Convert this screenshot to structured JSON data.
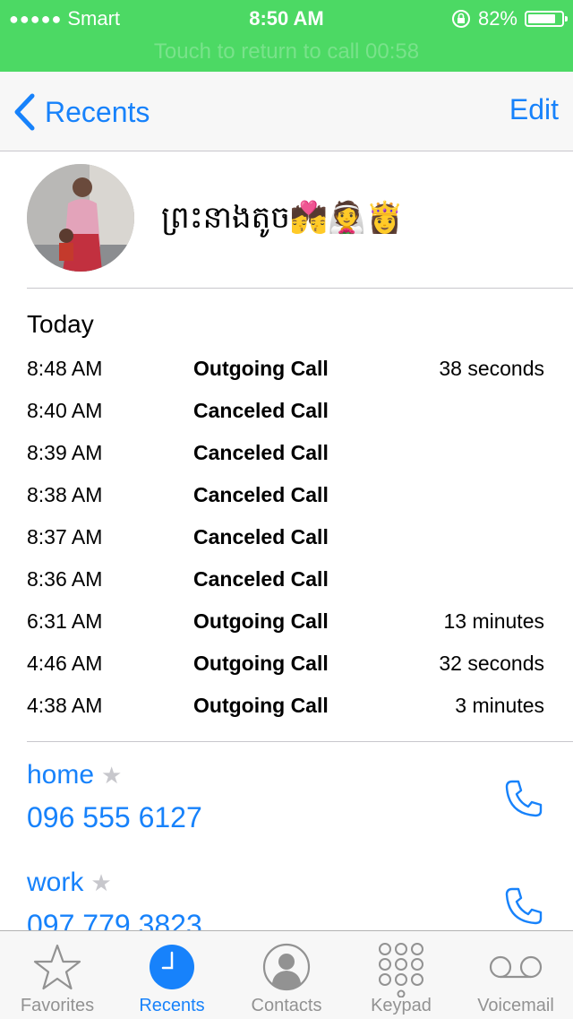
{
  "status_bar": {
    "signal": "●●●●●",
    "carrier": "Smart",
    "time": "8:50 AM",
    "battery_percent_label": "82%",
    "battery_level": 0.82,
    "return_hint": "Touch to return to call 00:58",
    "background_color": "#4cd964"
  },
  "nav": {
    "back_label": "Recents",
    "edit_label": "Edit",
    "accent_color": "#1782fb"
  },
  "contact": {
    "name": "ព្រះនាងតូច💏👰👸"
  },
  "call_log": {
    "day": "Today",
    "rows": [
      {
        "time": "8:48 AM",
        "kind": "Outgoing Call",
        "duration": "38 seconds"
      },
      {
        "time": "8:40 AM",
        "kind": "Canceled Call",
        "duration": ""
      },
      {
        "time": "8:39 AM",
        "kind": "Canceled Call",
        "duration": ""
      },
      {
        "time": "8:38 AM",
        "kind": "Canceled Call",
        "duration": ""
      },
      {
        "time": "8:37 AM",
        "kind": "Canceled Call",
        "duration": ""
      },
      {
        "time": "8:36 AM",
        "kind": "Canceled Call",
        "duration": ""
      },
      {
        "time": "6:31 AM",
        "kind": "Outgoing Call",
        "duration": "13 minutes"
      },
      {
        "time": "4:46 AM",
        "kind": "Outgoing Call",
        "duration": "32 seconds"
      },
      {
        "time": "4:38 AM",
        "kind": "Outgoing Call",
        "duration": "3 minutes"
      }
    ]
  },
  "phones": [
    {
      "label": "home",
      "number": "096 555 6127"
    },
    {
      "label": "work",
      "number": "097 779 3823"
    }
  ],
  "tabs": [
    {
      "label": "Favorites",
      "icon": "star-icon",
      "active": false
    },
    {
      "label": "Recents",
      "icon": "clock-icon",
      "active": true
    },
    {
      "label": "Contacts",
      "icon": "contact-icon",
      "active": false
    },
    {
      "label": "Keypad",
      "icon": "keypad-icon",
      "active": false
    },
    {
      "label": "Voicemail",
      "icon": "voicemail-icon",
      "active": false
    }
  ]
}
